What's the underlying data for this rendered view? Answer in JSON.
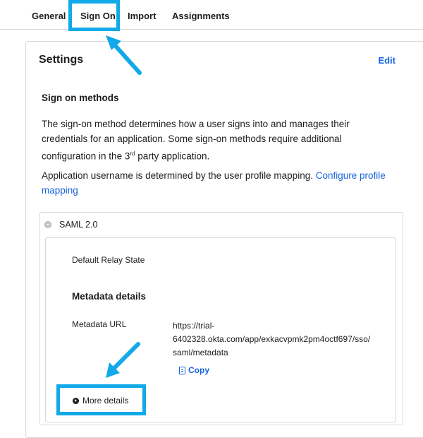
{
  "tabs": {
    "general": "General",
    "sign_on": "Sign On",
    "import": "Import",
    "assignments": "Assignments"
  },
  "settings": {
    "title": "Settings",
    "edit_label": "Edit"
  },
  "sign_on_methods": {
    "title": "Sign on methods",
    "description_pre": "The sign-on method determines how a user signs into and manages their credentials for an application. Some sign-on methods require additional configuration in the 3",
    "description_sup": "rd",
    "description_post": " party application.",
    "username_text": "Application username is determined by the user profile mapping. ",
    "configure_link": "Configure profile mapping"
  },
  "saml": {
    "option_label": "SAML 2.0",
    "relay_state_label": "Default Relay State",
    "metadata_title": "Metadata details",
    "metadata_url_label": "Metadata URL",
    "metadata_url_line1": "https://trial-",
    "metadata_url_line2": "6402328.okta.com/app/exkacvpmk2pm4octf697/sso/",
    "metadata_url_line3": "saml/metadata",
    "copy_label": "Copy",
    "more_details_label": "More details"
  },
  "colors": {
    "accent": "#1662dd",
    "annotation": "#12a9e8",
    "border": "#d7d7dc"
  },
  "icons": {
    "copy": "copy-icon",
    "more_details": "play-circle-icon",
    "radio": "radio-icon"
  }
}
